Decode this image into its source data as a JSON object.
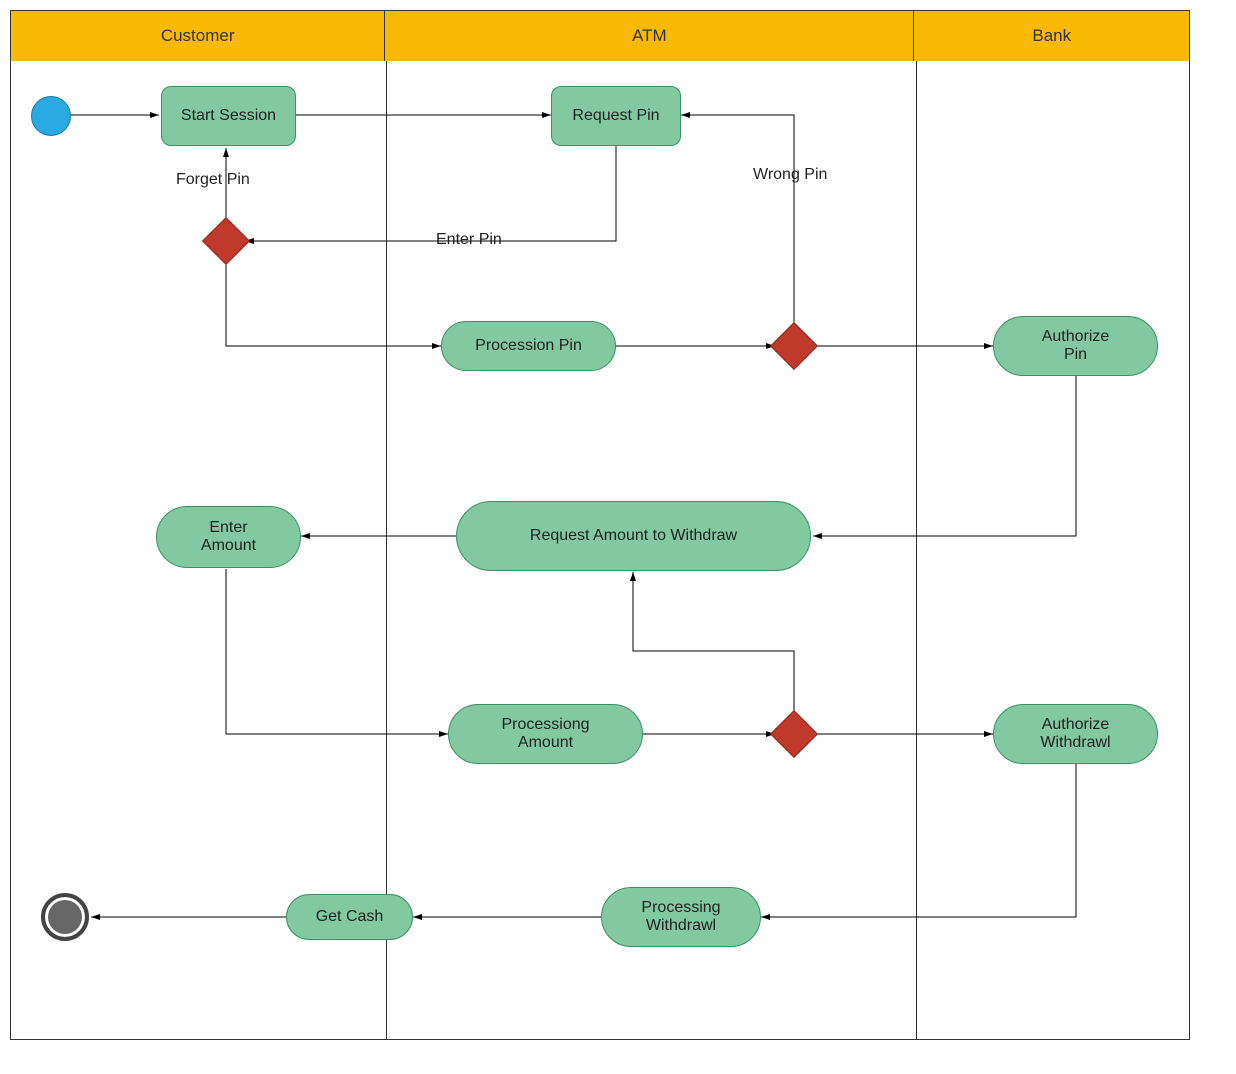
{
  "lanes": {
    "customer": "Customer",
    "atm": "ATM",
    "bank": "Bank"
  },
  "nodes": {
    "start_session": "Start Session",
    "request_pin": "Request Pin",
    "procession_pin": "Procession Pin",
    "authorize_pin": "Authorize\nPin",
    "request_amount": "Request Amount to Withdraw",
    "enter_amount": "Enter\nAmount",
    "processing_amount": "Processiong\nAmount",
    "authorize_withdrawl": "Authorize\nWithdrawl",
    "processing_withdrawl": "Processing\nWithdrawl",
    "get_cash": "Get Cash"
  },
  "edges": {
    "forget_pin": "Forget Pin",
    "enter_pin": "Enter Pin",
    "wrong_pin": "Wrong Pin"
  }
}
